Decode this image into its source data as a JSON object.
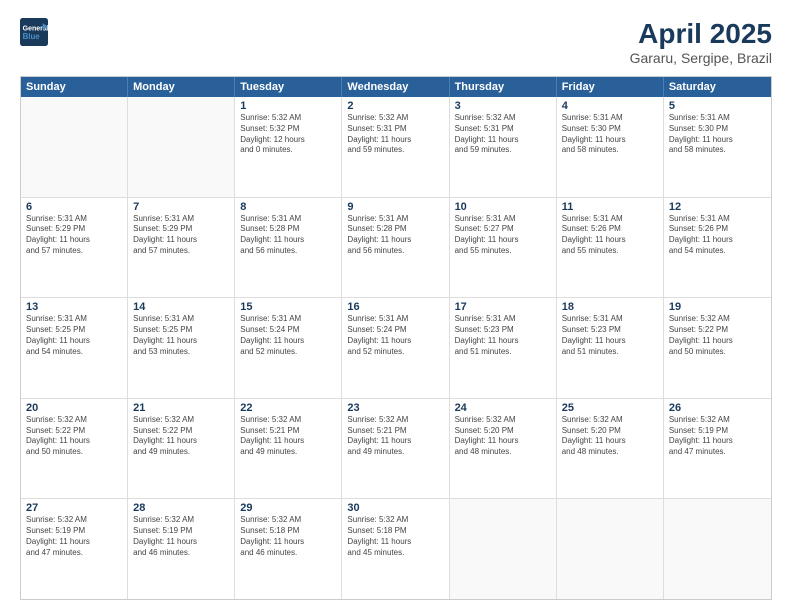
{
  "logo": {
    "line1": "General",
    "line2": "Blue"
  },
  "title": "April 2025",
  "subtitle": "Gararu, Sergipe, Brazil",
  "header_days": [
    "Sunday",
    "Monday",
    "Tuesday",
    "Wednesday",
    "Thursday",
    "Friday",
    "Saturday"
  ],
  "weeks": [
    [
      {
        "day": "",
        "info": ""
      },
      {
        "day": "",
        "info": ""
      },
      {
        "day": "1",
        "info": "Sunrise: 5:32 AM\nSunset: 5:32 PM\nDaylight: 12 hours\nand 0 minutes."
      },
      {
        "day": "2",
        "info": "Sunrise: 5:32 AM\nSunset: 5:31 PM\nDaylight: 11 hours\nand 59 minutes."
      },
      {
        "day": "3",
        "info": "Sunrise: 5:32 AM\nSunset: 5:31 PM\nDaylight: 11 hours\nand 59 minutes."
      },
      {
        "day": "4",
        "info": "Sunrise: 5:31 AM\nSunset: 5:30 PM\nDaylight: 11 hours\nand 58 minutes."
      },
      {
        "day": "5",
        "info": "Sunrise: 5:31 AM\nSunset: 5:30 PM\nDaylight: 11 hours\nand 58 minutes."
      }
    ],
    [
      {
        "day": "6",
        "info": "Sunrise: 5:31 AM\nSunset: 5:29 PM\nDaylight: 11 hours\nand 57 minutes."
      },
      {
        "day": "7",
        "info": "Sunrise: 5:31 AM\nSunset: 5:29 PM\nDaylight: 11 hours\nand 57 minutes."
      },
      {
        "day": "8",
        "info": "Sunrise: 5:31 AM\nSunset: 5:28 PM\nDaylight: 11 hours\nand 56 minutes."
      },
      {
        "day": "9",
        "info": "Sunrise: 5:31 AM\nSunset: 5:28 PM\nDaylight: 11 hours\nand 56 minutes."
      },
      {
        "day": "10",
        "info": "Sunrise: 5:31 AM\nSunset: 5:27 PM\nDaylight: 11 hours\nand 55 minutes."
      },
      {
        "day": "11",
        "info": "Sunrise: 5:31 AM\nSunset: 5:26 PM\nDaylight: 11 hours\nand 55 minutes."
      },
      {
        "day": "12",
        "info": "Sunrise: 5:31 AM\nSunset: 5:26 PM\nDaylight: 11 hours\nand 54 minutes."
      }
    ],
    [
      {
        "day": "13",
        "info": "Sunrise: 5:31 AM\nSunset: 5:25 PM\nDaylight: 11 hours\nand 54 minutes."
      },
      {
        "day": "14",
        "info": "Sunrise: 5:31 AM\nSunset: 5:25 PM\nDaylight: 11 hours\nand 53 minutes."
      },
      {
        "day": "15",
        "info": "Sunrise: 5:31 AM\nSunset: 5:24 PM\nDaylight: 11 hours\nand 52 minutes."
      },
      {
        "day": "16",
        "info": "Sunrise: 5:31 AM\nSunset: 5:24 PM\nDaylight: 11 hours\nand 52 minutes."
      },
      {
        "day": "17",
        "info": "Sunrise: 5:31 AM\nSunset: 5:23 PM\nDaylight: 11 hours\nand 51 minutes."
      },
      {
        "day": "18",
        "info": "Sunrise: 5:31 AM\nSunset: 5:23 PM\nDaylight: 11 hours\nand 51 minutes."
      },
      {
        "day": "19",
        "info": "Sunrise: 5:32 AM\nSunset: 5:22 PM\nDaylight: 11 hours\nand 50 minutes."
      }
    ],
    [
      {
        "day": "20",
        "info": "Sunrise: 5:32 AM\nSunset: 5:22 PM\nDaylight: 11 hours\nand 50 minutes."
      },
      {
        "day": "21",
        "info": "Sunrise: 5:32 AM\nSunset: 5:22 PM\nDaylight: 11 hours\nand 49 minutes."
      },
      {
        "day": "22",
        "info": "Sunrise: 5:32 AM\nSunset: 5:21 PM\nDaylight: 11 hours\nand 49 minutes."
      },
      {
        "day": "23",
        "info": "Sunrise: 5:32 AM\nSunset: 5:21 PM\nDaylight: 11 hours\nand 49 minutes."
      },
      {
        "day": "24",
        "info": "Sunrise: 5:32 AM\nSunset: 5:20 PM\nDaylight: 11 hours\nand 48 minutes."
      },
      {
        "day": "25",
        "info": "Sunrise: 5:32 AM\nSunset: 5:20 PM\nDaylight: 11 hours\nand 48 minutes."
      },
      {
        "day": "26",
        "info": "Sunrise: 5:32 AM\nSunset: 5:19 PM\nDaylight: 11 hours\nand 47 minutes."
      }
    ],
    [
      {
        "day": "27",
        "info": "Sunrise: 5:32 AM\nSunset: 5:19 PM\nDaylight: 11 hours\nand 47 minutes."
      },
      {
        "day": "28",
        "info": "Sunrise: 5:32 AM\nSunset: 5:19 PM\nDaylight: 11 hours\nand 46 minutes."
      },
      {
        "day": "29",
        "info": "Sunrise: 5:32 AM\nSunset: 5:18 PM\nDaylight: 11 hours\nand 46 minutes."
      },
      {
        "day": "30",
        "info": "Sunrise: 5:32 AM\nSunset: 5:18 PM\nDaylight: 11 hours\nand 45 minutes."
      },
      {
        "day": "",
        "info": ""
      },
      {
        "day": "",
        "info": ""
      },
      {
        "day": "",
        "info": ""
      }
    ]
  ]
}
